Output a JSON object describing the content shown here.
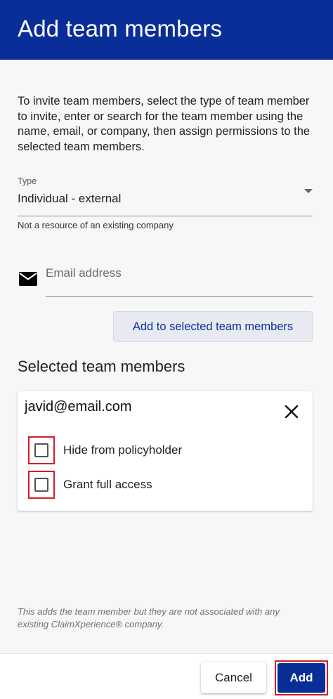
{
  "header": {
    "title": "Add team members"
  },
  "intro": {
    "text": "To invite team members, select the type of team member to invite, enter or search for the team member using the name, email, or company, then assign permissions to the selected team members."
  },
  "type_field": {
    "label": "Type",
    "value": "Individual - external",
    "helper": "Not a resource of an existing company"
  },
  "email_field": {
    "placeholder": "Email address",
    "value": ""
  },
  "add_selected_button": {
    "label": "Add to selected team members"
  },
  "selected_section": {
    "heading": "Selected team members",
    "members": [
      {
        "email": "javid@email.com",
        "options": [
          {
            "label": "Hide from policyholder",
            "checked": false
          },
          {
            "label": "Grant full access",
            "checked": false
          }
        ]
      }
    ]
  },
  "footnote": {
    "text": "This adds the team member but they are not associated with any existing ClaimXperience® company."
  },
  "footer": {
    "cancel_label": "Cancel",
    "add_label": "Add"
  },
  "colors": {
    "brand": "#0a2e97",
    "highlight": "#d21f26"
  },
  "icons": {
    "email": "mail-icon",
    "remove": "close-icon",
    "dropdown": "chevron-down-icon"
  }
}
